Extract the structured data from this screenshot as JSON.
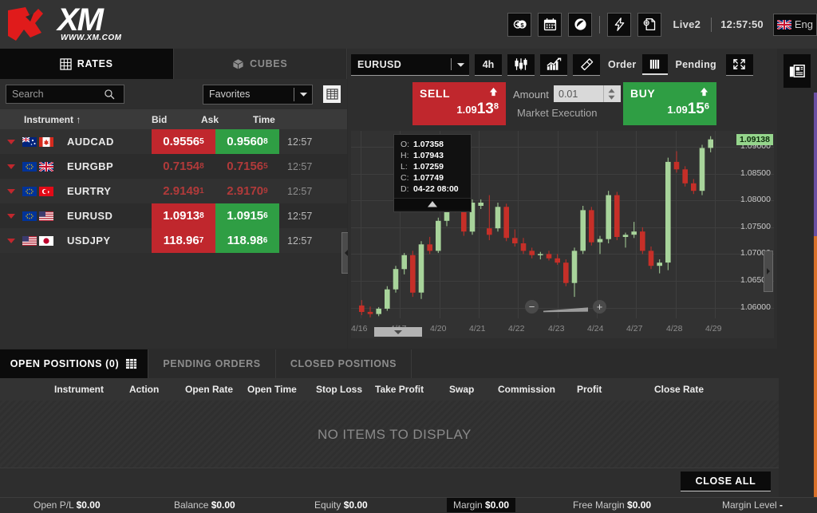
{
  "header": {
    "logo_text": "XM",
    "logo_url": "WWW.XM.COM",
    "icons": [
      {
        "name": "deposit-icon",
        "label": "Deposit"
      },
      {
        "name": "calendar-icon",
        "label": "Calendar"
      },
      {
        "name": "circle-slash-icon",
        "label": "Economic"
      },
      {
        "name": "lightning-icon",
        "label": "One Click Trading"
      },
      {
        "name": "new-document-icon",
        "label": "New Chart"
      }
    ],
    "account": "Live2",
    "time": "12:57:50",
    "language": "Eng"
  },
  "left_panel": {
    "tabs": [
      {
        "label": "RATES",
        "icon": "grid-icon",
        "active": true
      },
      {
        "label": "CUBES",
        "icon": "cube-icon",
        "active": false
      }
    ],
    "search_placeholder": "Search",
    "search_value": "",
    "favorites_label": "Favorites",
    "columns": [
      "Instrument ↑",
      "Bid",
      "Ask",
      "Time"
    ],
    "rows": [
      {
        "instrument": "AUDCAD",
        "flag_left": "au",
        "flag_right": "ca",
        "bid_main": "0.9556",
        "bid_sup": "5",
        "ask_main": "0.9560",
        "ask_sup": "8",
        "time": "12:57",
        "style": "colored"
      },
      {
        "instrument": "EURGBP",
        "flag_left": "eu",
        "flag_right": "gb",
        "bid_main": "0.7154",
        "bid_sup": "8",
        "ask_main": "0.7156",
        "ask_sup": "5",
        "time": "12:57",
        "style": "flat"
      },
      {
        "instrument": "EURTRY",
        "flag_left": "eu",
        "flag_right": "tr",
        "bid_main": "2.9149",
        "bid_sup": "1",
        "ask_main": "2.9170",
        "ask_sup": "9",
        "time": "12:57",
        "style": "flat"
      },
      {
        "instrument": "EURUSD",
        "flag_left": "eu",
        "flag_right": "us",
        "bid_main": "1.0913",
        "bid_sup": "8",
        "ask_main": "1.0915",
        "ask_sup": "6",
        "time": "12:57",
        "style": "colored"
      },
      {
        "instrument": "USDJPY",
        "flag_left": "us",
        "flag_right": "jp",
        "bid_main": "118.96",
        "bid_sup": "7",
        "ask_main": "118.98",
        "ask_sup": "6",
        "time": "12:57",
        "style": "colored"
      }
    ]
  },
  "chart_panel": {
    "symbol": "EURUSD",
    "timeframe": "4h",
    "order_label": "Order",
    "pending_label": "Pending",
    "tools": [
      {
        "name": "candlestick-icon"
      },
      {
        "name": "indicator-chart-icon"
      },
      {
        "name": "drawing-tool-icon"
      }
    ],
    "fullscreen_icon": "expand-icon",
    "order": {
      "sell_label": "SELL",
      "sell_price_prefix": "1.09",
      "sell_price_big": "13",
      "sell_price_sup": "8",
      "buy_label": "BUY",
      "buy_price_prefix": "1.09",
      "buy_price_big": "15",
      "buy_price_sup": "6",
      "amount_label": "Amount",
      "amount_value": "0.01",
      "execution": "Market Execution"
    },
    "tooltip": {
      "open_key": "O:",
      "open": "1.07358",
      "high_key": "H:",
      "high": "1.07943",
      "low_key": "L:",
      "low": "1.07259",
      "close_key": "C:",
      "close": "1.07749",
      "date_key": "D:",
      "date": "04-22 08:00"
    },
    "current_price": "1.09138"
  },
  "chart_data": {
    "type": "candlestick",
    "title": "EURUSD 4h",
    "xlabel": "",
    "ylabel": "",
    "ylim": [
      1.058,
      1.093
    ],
    "grid": true,
    "legend": "none",
    "price_ticks": [
      "1.09000",
      "1.08500",
      "1.08000",
      "1.07500",
      "1.07000",
      "1.06500",
      "1.06000"
    ],
    "price_tick_values": [
      1.09,
      1.085,
      1.08,
      1.075,
      1.07,
      1.065,
      1.06
    ],
    "current_price": 1.09138,
    "time_ticks": [
      "4/16",
      "4/17",
      "4/20",
      "4/21",
      "4/22",
      "4/23",
      "4/24",
      "4/27",
      "4/28",
      "4/29"
    ],
    "colors": {
      "up": "#a8d49b",
      "down": "#c62f28",
      "background": "#323232",
      "grid": "#3e3e3e"
    },
    "candles": [
      {
        "o": 1.0604,
        "h": 1.0614,
        "l": 1.0586,
        "c": 1.0592,
        "dir": "down"
      },
      {
        "o": 1.0592,
        "h": 1.0602,
        "l": 1.0582,
        "c": 1.0588,
        "dir": "down"
      },
      {
        "o": 1.0588,
        "h": 1.0601,
        "l": 1.0584,
        "c": 1.0598,
        "dir": "up"
      },
      {
        "o": 1.0598,
        "h": 1.064,
        "l": 1.0594,
        "c": 1.0634,
        "dir": "up"
      },
      {
        "o": 1.0634,
        "h": 1.0678,
        "l": 1.0628,
        "c": 1.0672,
        "dir": "up"
      },
      {
        "o": 1.0672,
        "h": 1.0702,
        "l": 1.0662,
        "c": 1.0698,
        "dir": "up"
      },
      {
        "o": 1.0698,
        "h": 1.0706,
        "l": 1.062,
        "c": 1.0628,
        "dir": "down"
      },
      {
        "o": 1.0628,
        "h": 1.0724,
        "l": 1.0616,
        "c": 1.0718,
        "dir": "up"
      },
      {
        "o": 1.0718,
        "h": 1.0732,
        "l": 1.07,
        "c": 1.0706,
        "dir": "down"
      },
      {
        "o": 1.0706,
        "h": 1.0768,
        "l": 1.0702,
        "c": 1.0762,
        "dir": "up"
      },
      {
        "o": 1.0762,
        "h": 1.0796,
        "l": 1.0752,
        "c": 1.079,
        "dir": "up"
      },
      {
        "o": 1.079,
        "h": 1.0804,
        "l": 1.0778,
        "c": 1.0784,
        "dir": "down"
      },
      {
        "o": 1.0784,
        "h": 1.08,
        "l": 1.0734,
        "c": 1.0742,
        "dir": "down"
      },
      {
        "o": 1.0742,
        "h": 1.0802,
        "l": 1.0736,
        "c": 1.0796,
        "dir": "up"
      },
      {
        "o": 1.0796,
        "h": 1.0802,
        "l": 1.0784,
        "c": 1.079,
        "dir": "up"
      },
      {
        "o": 1.0736,
        "h": 1.081,
        "l": 1.0726,
        "c": 1.0748,
        "dir": "down"
      },
      {
        "o": 1.0748,
        "h": 1.0796,
        "l": 1.0742,
        "c": 1.0788,
        "dir": "up"
      },
      {
        "o": 1.0788,
        "h": 1.0794,
        "l": 1.0724,
        "c": 1.073,
        "dir": "down"
      },
      {
        "o": 1.073,
        "h": 1.0746,
        "l": 1.0714,
        "c": 1.072,
        "dir": "down"
      },
      {
        "o": 1.072,
        "h": 1.073,
        "l": 1.07,
        "c": 1.0706,
        "dir": "down"
      },
      {
        "o": 1.0706,
        "h": 1.0712,
        "l": 1.0692,
        "c": 1.0698,
        "dir": "down"
      },
      {
        "o": 1.0698,
        "h": 1.0704,
        "l": 1.069,
        "c": 1.07,
        "dir": "up"
      },
      {
        "o": 1.07,
        "h": 1.0706,
        "l": 1.0688,
        "c": 1.0692,
        "dir": "down"
      },
      {
        "o": 1.0692,
        "h": 1.07,
        "l": 1.068,
        "c": 1.0684,
        "dir": "down"
      },
      {
        "o": 1.0684,
        "h": 1.069,
        "l": 1.064,
        "c": 1.0646,
        "dir": "down"
      },
      {
        "o": 1.0646,
        "h": 1.0712,
        "l": 1.062,
        "c": 1.0706,
        "dir": "up"
      },
      {
        "o": 1.0706,
        "h": 1.079,
        "l": 1.07,
        "c": 1.0782,
        "dir": "up"
      },
      {
        "o": 1.0782,
        "h": 1.0788,
        "l": 1.0716,
        "c": 1.0722,
        "dir": "down"
      },
      {
        "o": 1.0722,
        "h": 1.0734,
        "l": 1.07,
        "c": 1.0728,
        "dir": "up"
      },
      {
        "o": 1.0728,
        "h": 1.0818,
        "l": 1.072,
        "c": 1.081,
        "dir": "up"
      },
      {
        "o": 1.081,
        "h": 1.0816,
        "l": 1.0726,
        "c": 1.0732,
        "dir": "down"
      },
      {
        "o": 1.0732,
        "h": 1.074,
        "l": 1.0712,
        "c": 1.0736,
        "dir": "up"
      },
      {
        "o": 1.0736,
        "h": 1.076,
        "l": 1.073,
        "c": 1.0742,
        "dir": "up"
      },
      {
        "o": 1.0742,
        "h": 1.075,
        "l": 1.07,
        "c": 1.0706,
        "dir": "down"
      },
      {
        "o": 1.0706,
        "h": 1.0714,
        "l": 1.0672,
        "c": 1.0678,
        "dir": "down"
      },
      {
        "o": 1.0678,
        "h": 1.069,
        "l": 1.0664,
        "c": 1.0684,
        "dir": "up"
      },
      {
        "o": 1.0684,
        "h": 1.088,
        "l": 1.067,
        "c": 1.0872,
        "dir": "up"
      },
      {
        "o": 1.0872,
        "h": 1.0892,
        "l": 1.0852,
        "c": 1.0858,
        "dir": "down"
      },
      {
        "o": 1.0858,
        "h": 1.0864,
        "l": 1.0826,
        "c": 1.0832,
        "dir": "down"
      },
      {
        "o": 1.0832,
        "h": 1.084,
        "l": 1.0812,
        "c": 1.0818,
        "dir": "down"
      },
      {
        "o": 1.0818,
        "h": 1.0904,
        "l": 1.081,
        "c": 1.0898,
        "dir": "up"
      },
      {
        "o": 1.0898,
        "h": 1.092,
        "l": 1.089,
        "c": 1.0914,
        "dir": "up"
      }
    ]
  },
  "bottom_panel": {
    "tabs": [
      {
        "label": "OPEN POSITIONS (0)",
        "active": true,
        "icon": "grid-icon"
      },
      {
        "label": "PENDING ORDERS",
        "active": false
      },
      {
        "label": "CLOSED POSITIONS",
        "active": false
      }
    ],
    "columns": [
      "Instrument",
      "Action",
      "Open Rate",
      "Open Time",
      "Stop Loss",
      "Take Profit",
      "Swap",
      "Commission",
      "Profit",
      "Close Rate"
    ],
    "empty_message": "NO ITEMS TO DISPLAY",
    "close_all_label": "CLOSE ALL"
  },
  "status_bar": {
    "items": [
      {
        "label": "Open P/L",
        "value": "$0.00",
        "highlight": false
      },
      {
        "label": "Balance",
        "value": "$0.00",
        "highlight": false
      },
      {
        "label": "Equity",
        "value": "$0.00",
        "highlight": false
      },
      {
        "label": "Margin",
        "value": "$0.00",
        "highlight": true
      },
      {
        "label": "Free Margin",
        "value": "$0.00",
        "highlight": false
      },
      {
        "label": "Margin Level",
        "value": "-",
        "highlight": false
      }
    ]
  }
}
